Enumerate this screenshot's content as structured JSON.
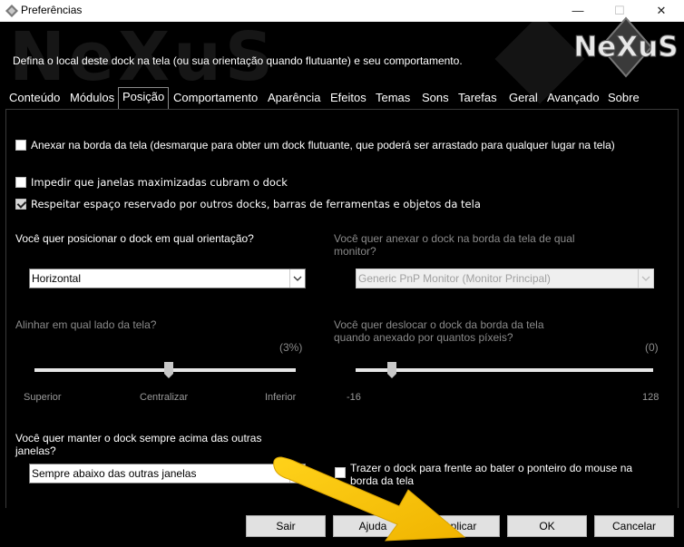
{
  "window": {
    "title": "Preferências",
    "controls": {
      "minimize": "—",
      "maximize": "☐",
      "close": "✕"
    }
  },
  "banner": {
    "description": "Defina o local deste dock na tela (ou sua orientação quando flutuante) e seu comportamento.",
    "watermark": "NeXuS",
    "logo_text": "NeXuS"
  },
  "tabs": [
    {
      "label": "Conteúdo"
    },
    {
      "label": "Módulos"
    },
    {
      "label": "Posição"
    },
    {
      "label": "Comportamento"
    },
    {
      "label": "Aparência"
    },
    {
      "label": "Efeitos"
    },
    {
      "label": "Temas"
    },
    {
      "label": "Sons"
    },
    {
      "label": "Tarefas"
    },
    {
      "label": "Geral"
    },
    {
      "label": "Avançado"
    },
    {
      "label": "Sobre"
    }
  ],
  "active_tab": "Posição",
  "options": {
    "attach_edge": {
      "label": "Anexar na borda da tela (desmarque para obter um dock flutuante, que poderá ser arrastado para qualquer lugar na tela)",
      "checked": false
    },
    "prevent_maximized": {
      "label": "Impedir que janelas maximizadas cubram o dock",
      "checked": false
    },
    "respect_reserved": {
      "label": "Respeitar espaço reservado por outros docks, barras de ferramentas e objetos da tela",
      "checked": true
    }
  },
  "orientation": {
    "question": "Você quer posicionar o dock em qual orientação?",
    "selected": "Horizontal"
  },
  "monitor": {
    "question": "Você quer anexar o dock na borda da tela de qual monitor?",
    "selected": "Generic PnP Monitor (Monitor Principal)",
    "enabled": false
  },
  "align": {
    "question": "Alinhar em qual lado da tela?",
    "value_text": "(3%)",
    "value": 3,
    "min_label": "Superior",
    "mid_label": "Centralizar",
    "max_label": "Inferior",
    "enabled": false
  },
  "offset": {
    "question": "Você quer deslocar o dock da borda da tela quando anexado por quantos píxeis?",
    "value_text": "(0)",
    "value": 0,
    "min": -16,
    "max": 128,
    "min_label": "-16",
    "max_label": "128",
    "enabled": false
  },
  "layer": {
    "question": "Você quer manter o dock sempre acima das outras janelas?",
    "selected": "Sempre abaixo das outras janelas"
  },
  "bring_front": {
    "label": "Trazer o dock para frente ao bater o ponteiro do mouse na borda da tela",
    "checked": false
  },
  "buttons": {
    "exit": "Sair",
    "help": "Ajuda",
    "apply": "Aplicar",
    "ok": "OK",
    "cancel": "Cancelar"
  },
  "colors": {
    "background": "#000000",
    "annotation_arrow": "#f5c400"
  }
}
